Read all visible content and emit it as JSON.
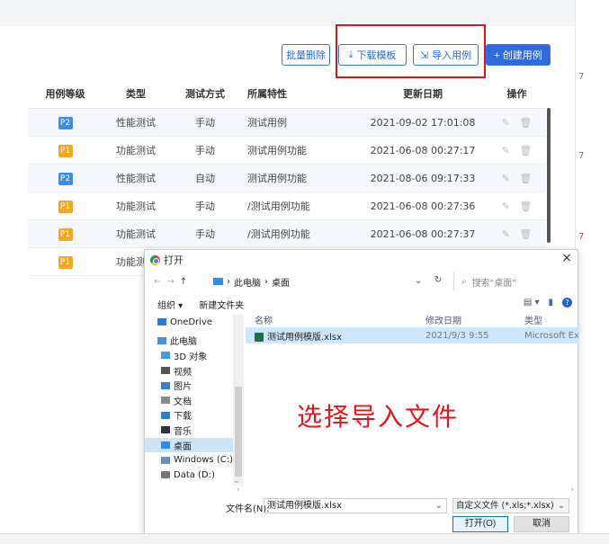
{
  "toolbar": {
    "batch_delete": "批量删除",
    "download_template": "下载模板",
    "import_cases": "导入用例",
    "create_case": "+ 创建用例"
  },
  "table": {
    "headers": [
      "用例等级",
      "类型",
      "测试方式",
      "所属特性",
      "更新日期",
      "操作"
    ],
    "rows": [
      {
        "level": "P2",
        "type": "性能测试",
        "method": "手动",
        "feature": "测试用例",
        "updated": "2021-09-02 17:01:08"
      },
      {
        "level": "P1",
        "type": "功能测试",
        "method": "手动",
        "feature": "测试用例功能",
        "updated": "2021-06-08 00:27:17"
      },
      {
        "level": "P2",
        "type": "性能测试",
        "method": "自动",
        "feature": "测试用例功能",
        "updated": "2021-08-06 09:17:33"
      },
      {
        "level": "P1",
        "type": "功能测试",
        "method": "手动",
        "feature": "/测试用例功能",
        "updated": "2021-06-08 00:27:36"
      },
      {
        "level": "P1",
        "type": "功能测试",
        "method": "手动",
        "feature": "/测试用例功能",
        "updated": "2021-06-08 00:27:37"
      },
      {
        "level": "P1",
        "type": "功能测试",
        "method": "",
        "feature": "",
        "updated": ""
      }
    ]
  },
  "dialog": {
    "title": "打开",
    "breadcrumb": [
      "此电脑",
      "桌面"
    ],
    "search_placeholder": "搜索\"桌面\"",
    "organize": "组织 ▾",
    "new_folder": "新建文件夹",
    "nav": [
      "OneDrive",
      "此电脑",
      "3D 对象",
      "视频",
      "图片",
      "文档",
      "下载",
      "音乐",
      "桌面",
      "Windows (C:)",
      "Data (D:)"
    ],
    "columns": {
      "name": "名称",
      "date": "修改日期",
      "type": "类型"
    },
    "file": {
      "name": "测试用例模版.xlsx",
      "date": "2021/9/3 9:55",
      "type": "Microsoft Ex"
    },
    "filename_label": "文件名(N):",
    "filename_value": "测试用例模版.xlsx",
    "filter": "自定义文件 (*.xls;*.xlsx)",
    "open": "打开(O)",
    "cancel": "取消"
  },
  "caption": "选择导入文件",
  "colors": {
    "primary": "#2f6ae0",
    "p1": "#f5a623",
    "p2": "#3a8ee6",
    "highlight": "#e0121a"
  }
}
